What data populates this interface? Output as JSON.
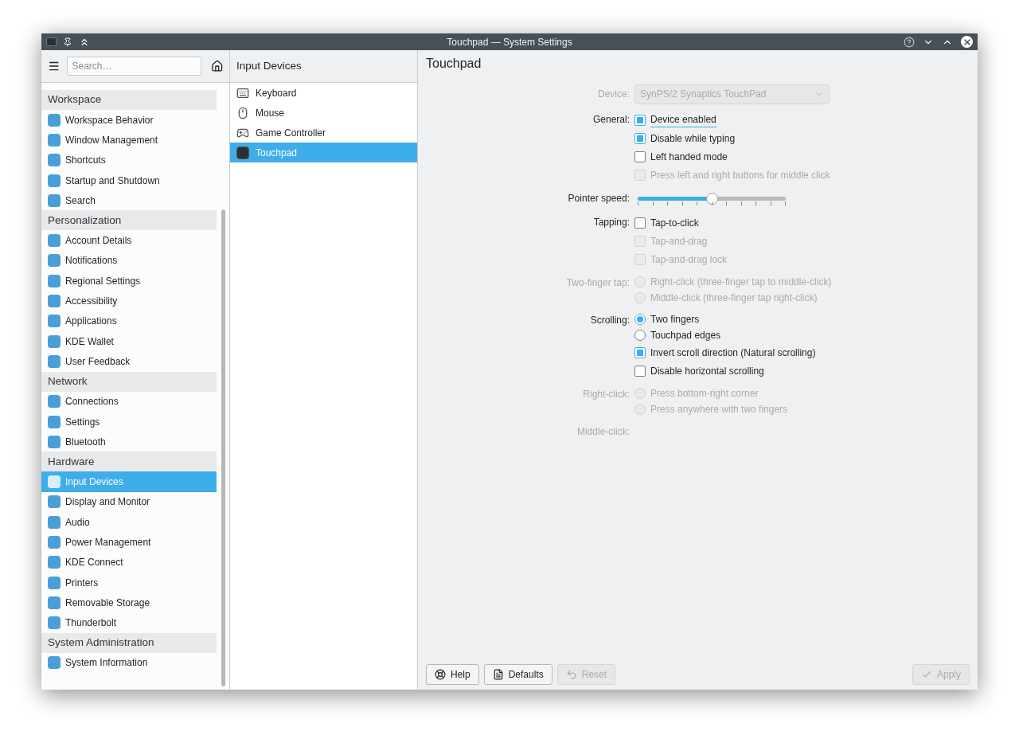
{
  "window": {
    "title": "Touchpad — System Settings"
  },
  "sidebar": {
    "search": {
      "placeholder": "Search…"
    },
    "categories": [
      {
        "title": "Workspace",
        "items": [
          {
            "label": "Workspace Behavior",
            "selected": false
          },
          {
            "label": "Window Management",
            "selected": false
          },
          {
            "label": "Shortcuts",
            "selected": false
          },
          {
            "label": "Startup and Shutdown",
            "selected": false
          },
          {
            "label": "Search",
            "selected": false
          }
        ]
      },
      {
        "title": "Personalization",
        "items": [
          {
            "label": "Account Details",
            "selected": false
          },
          {
            "label": "Notifications",
            "selected": false
          },
          {
            "label": "Regional Settings",
            "selected": false
          },
          {
            "label": "Accessibility",
            "selected": false
          },
          {
            "label": "Applications",
            "selected": false
          },
          {
            "label": "KDE Wallet",
            "selected": false
          },
          {
            "label": "User Feedback",
            "selected": false
          }
        ]
      },
      {
        "title": "Network",
        "items": [
          {
            "label": "Connections",
            "selected": false
          },
          {
            "label": "Settings",
            "selected": false
          },
          {
            "label": "Bluetooth",
            "selected": false
          }
        ]
      },
      {
        "title": "Hardware",
        "items": [
          {
            "label": "Input Devices",
            "selected": true
          },
          {
            "label": "Display and Monitor",
            "selected": false
          },
          {
            "label": "Audio",
            "selected": false
          },
          {
            "label": "Power Management",
            "selected": false
          },
          {
            "label": "KDE Connect",
            "selected": false
          },
          {
            "label": "Printers",
            "selected": false
          },
          {
            "label": "Removable Storage",
            "selected": false
          },
          {
            "label": "Thunderbolt",
            "selected": false
          }
        ]
      },
      {
        "title": "System Administration",
        "items": [
          {
            "label": "System Information",
            "selected": false
          }
        ]
      }
    ]
  },
  "middle": {
    "title": "Input Devices",
    "items": [
      {
        "label": "Keyboard",
        "selected": false
      },
      {
        "label": "Mouse",
        "selected": false
      },
      {
        "label": "Game Controller",
        "selected": false
      },
      {
        "label": "Touchpad",
        "selected": true
      }
    ]
  },
  "page": {
    "title": "Touchpad",
    "device": {
      "label": "Device:",
      "value": "SynPS/2 Synaptics TouchPad",
      "disabled": true
    },
    "groups": [
      {
        "label": "General:",
        "disabled": false,
        "items": [
          {
            "kind": "checkbox",
            "label": "Device enabled",
            "checked": true,
            "disabled": false,
            "focused": true
          },
          {
            "kind": "checkbox",
            "label": "Disable while typing",
            "checked": true,
            "disabled": false,
            "focused": false
          },
          {
            "kind": "checkbox",
            "label": "Left handed mode",
            "checked": false,
            "disabled": false,
            "focused": false
          },
          {
            "kind": "checkbox",
            "label": "Press left and right buttons for middle click",
            "checked": false,
            "disabled": true,
            "focused": false
          }
        ]
      },
      {
        "label": "Pointer speed:",
        "disabled": false,
        "items": [
          {
            "kind": "slider",
            "level": 0.5
          }
        ]
      },
      {
        "label": "Tapping:",
        "disabled": false,
        "items": [
          {
            "kind": "checkbox",
            "label": "Tap-to-click",
            "checked": false,
            "disabled": false,
            "focused": false
          },
          {
            "kind": "checkbox",
            "label": "Tap-and-drag",
            "checked": false,
            "disabled": true,
            "focused": false
          },
          {
            "kind": "checkbox",
            "label": "Tap-and-drag lock",
            "checked": false,
            "disabled": true,
            "focused": false
          }
        ]
      },
      {
        "label": "Two-finger tap:",
        "disabled": true,
        "items": [
          {
            "kind": "radio",
            "label": "Right-click (three-finger tap to middle-click)",
            "selected": false,
            "disabled": true
          },
          {
            "kind": "radio",
            "label": "Middle-click (three-finger tap right-click)",
            "selected": false,
            "disabled": true
          }
        ]
      },
      {
        "label": "Scrolling:",
        "disabled": false,
        "items": [
          {
            "kind": "radio",
            "label": "Two fingers",
            "selected": true,
            "disabled": false
          },
          {
            "kind": "radio",
            "label": "Touchpad edges",
            "selected": false,
            "disabled": false
          },
          {
            "kind": "checkbox",
            "label": "Invert scroll direction (Natural scrolling)",
            "checked": true,
            "disabled": false,
            "focused": false
          },
          {
            "kind": "checkbox",
            "label": "Disable horizontal scrolling",
            "checked": false,
            "disabled": false,
            "focused": false
          }
        ]
      },
      {
        "label": "Right-click:",
        "disabled": true,
        "items": [
          {
            "kind": "radio",
            "label": "Press bottom-right corner",
            "selected": false,
            "disabled": true
          },
          {
            "kind": "radio",
            "label": "Press anywhere with two fingers",
            "selected": false,
            "disabled": true
          }
        ]
      },
      {
        "label": "Middle-click:",
        "disabled": true
      }
    ],
    "buttons": [
      {
        "kind": "help",
        "label": "Help",
        "disabled": false
      },
      {
        "kind": "defaults",
        "label": "Defaults",
        "disabled": false
      },
      {
        "kind": "reset",
        "label": "Reset",
        "disabled": true
      },
      {
        "kind": "apply",
        "label": "Apply",
        "disabled": true
      }
    ]
  }
}
